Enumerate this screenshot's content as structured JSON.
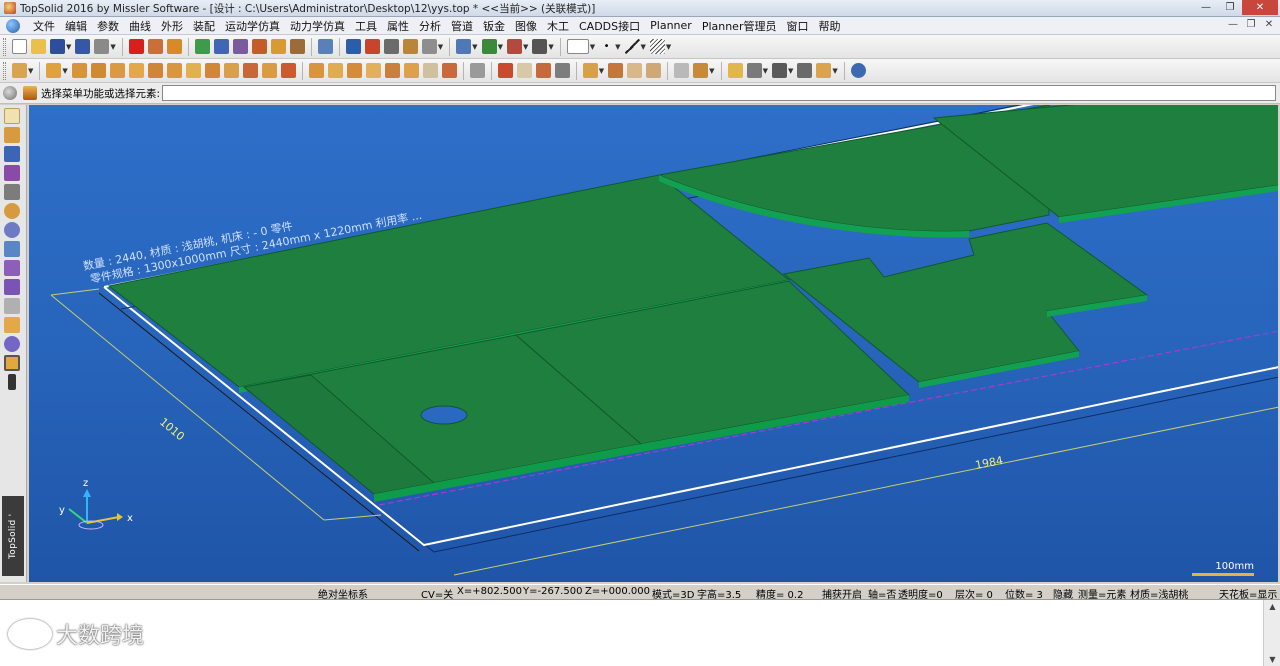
{
  "window": {
    "title": "TopSolid 2016 by Missler Software - [设计 : C:\\Users\\Administrator\\Desktop\\12\\yys.top *  <<当前>> (关联模式)]",
    "controls": [
      "—",
      "❐",
      "✕"
    ]
  },
  "menu": {
    "items": [
      "文件",
      "编辑",
      "参数",
      "曲线",
      "外形",
      "装配",
      "运动学仿真",
      "动力学仿真",
      "工具",
      "属性",
      "分析",
      "管道",
      "钣金",
      "图像",
      "木工",
      "CADDS接口",
      "Planner",
      "Planner管理员",
      "窗口",
      "帮助"
    ],
    "mdi_controls": [
      "—",
      "❐",
      "✕"
    ]
  },
  "command": {
    "prompt": "选择菜单功能或选择元素:",
    "input_value": ""
  },
  "viewport": {
    "dimension_length": "1984",
    "dimension_width": "1010",
    "annotation_line1": "数量 : 2440, 材质 : 浅胡桃, 机床 : - 0 零件",
    "annotation_line2": "零件规格 : 1300x1000mm 尺寸 : 2440mm x 1220mm 利用率 ...",
    "axis_labels": {
      "x": "x",
      "y": "y",
      "z": "z"
    },
    "scale_label": "100mm",
    "colors": {
      "background": "#2a68c2",
      "sheet": "#1d7a3e",
      "sheet_edge": "#0f9a4a",
      "outline": "#ffffff"
    }
  },
  "sidebar": {
    "brand": "TopSolid ' Design"
  },
  "status": {
    "coord_system": "绝对坐标系",
    "cv": "CV=关",
    "x": "X=+802.500",
    "y": "Y=-267.500",
    "z": "Z=+000.000",
    "mode": "模式=3D",
    "text_height": "字高=3.5",
    "precision": "精度=   0.2",
    "capture": "捕获开启",
    "axis": "轴=否",
    "transparency": "透明度=0",
    "layer": "层次=  0",
    "digits": "位数= 3",
    "hidden": "隐藏",
    "measure": "测量=元素",
    "material": "材质=浅胡桃",
    "ceiling": "天花板=显示"
  },
  "watermark": {
    "text": "大数跨境"
  }
}
